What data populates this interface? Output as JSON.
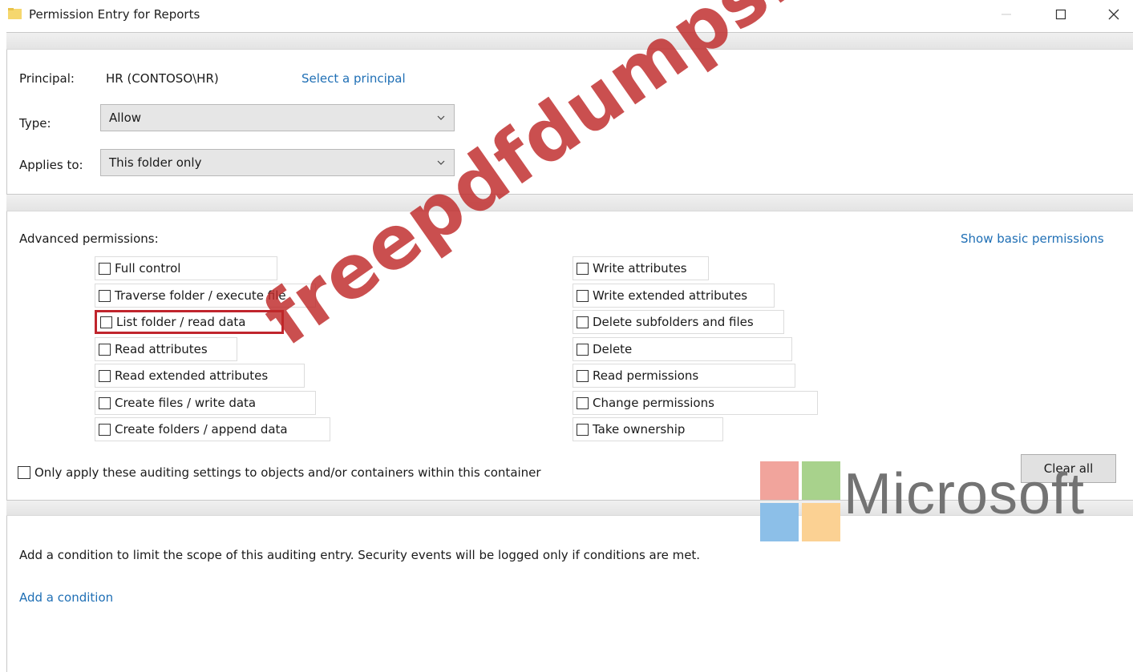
{
  "window": {
    "title": "Permission Entry for Reports",
    "controls": {
      "minimize": "—",
      "maximize": "☐",
      "close": "✕"
    }
  },
  "principal": {
    "label": "Principal:",
    "value": "HR (CONTOSO\\HR)",
    "link": "Select a principal"
  },
  "type": {
    "label": "Type:",
    "value": "Allow"
  },
  "applies_to": {
    "label": "Applies to:",
    "value": "This folder only"
  },
  "advanced": {
    "label": "Advanced permissions:",
    "show_basic_link": "Show basic permissions",
    "left": [
      "Full control",
      "Traverse folder / execute file",
      "List folder / read data",
      "Read attributes",
      "Read extended attributes",
      "Create files / write data",
      "Create folders / append data"
    ],
    "right": [
      "Write attributes",
      "Write extended attributes",
      "Delete subfolders and files",
      "Delete",
      "Read permissions",
      "Change permissions",
      "Take ownership"
    ]
  },
  "only_apply": "Only apply these auditing settings to objects and/or containers within this container",
  "clear_all": "Clear all",
  "condition_text": "Add a condition to limit the scope of this auditing entry. Security events will be logged only if conditions are met.",
  "add_condition": "Add a condition",
  "watermark": "freepdfdumps.com",
  "microsoft_logo": {
    "text": "Microsoft",
    "colors": [
      "#f1a49c",
      "#a8d28c",
      "#8cbfe8",
      "#fbd193"
    ]
  }
}
